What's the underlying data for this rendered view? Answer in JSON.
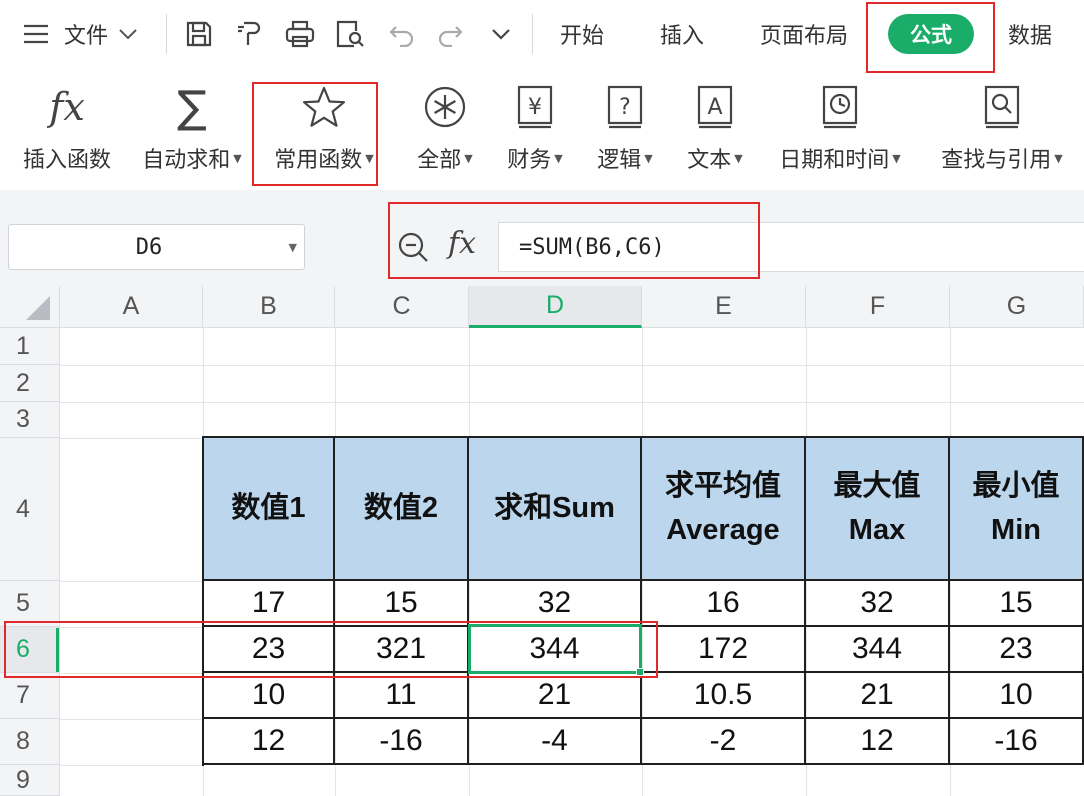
{
  "menubar": {
    "file_label": "文件",
    "tabs": [
      {
        "label": "开始"
      },
      {
        "label": "插入"
      },
      {
        "label": "页面布局"
      },
      {
        "label": "公式"
      },
      {
        "label": "数据"
      }
    ]
  },
  "ribbon": {
    "buttons": [
      {
        "label": "插入函数"
      },
      {
        "label": "自动求和"
      },
      {
        "label": "常用函数"
      },
      {
        "label": "全部"
      },
      {
        "label": "财务"
      },
      {
        "label": "逻辑"
      },
      {
        "label": "文本"
      },
      {
        "label": "日期和时间"
      },
      {
        "label": "查找与引用"
      }
    ]
  },
  "formula_bar": {
    "name_box": "D6",
    "formula": "=SUM(B6,C6)"
  },
  "grid": {
    "columns": [
      "A",
      "B",
      "C",
      "D",
      "E",
      "F",
      "G"
    ],
    "rows": [
      "1",
      "2",
      "3",
      "4",
      "5",
      "6",
      "7",
      "8",
      "9"
    ],
    "table_headers": [
      [
        "数值1"
      ],
      [
        "数值2"
      ],
      [
        "求和Sum"
      ],
      [
        "求平均值",
        "Average"
      ],
      [
        "最大值",
        "Max"
      ],
      [
        "最小值",
        "Min"
      ]
    ],
    "table_rows": [
      [
        "17",
        "15",
        "32",
        "16",
        "32",
        "15"
      ],
      [
        "23",
        "321",
        "344",
        "172",
        "344",
        "23"
      ],
      [
        "10",
        "11",
        "21",
        "10.5",
        "21",
        "10"
      ],
      [
        "12",
        "-16",
        "-4",
        "-2",
        "12",
        "-16"
      ]
    ],
    "active_cell": "D6"
  },
  "colors": {
    "accent": "#1aad6a",
    "highlight": "#e02a2a",
    "table_header_bg": "#bcd6ee"
  }
}
